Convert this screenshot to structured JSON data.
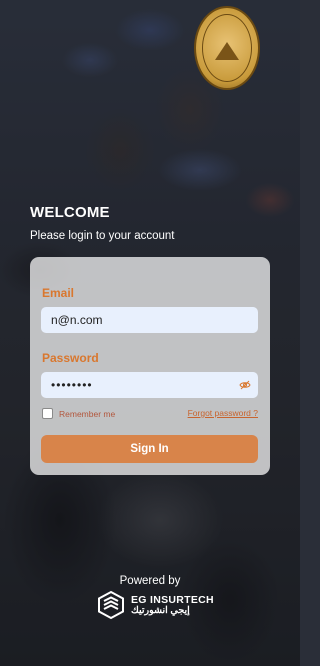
{
  "header": {
    "logo_icon": "association-seal-icon"
  },
  "welcome": {
    "title": "WELCOME",
    "subtitle": "Please login to your account"
  },
  "form": {
    "email_label": "Email",
    "email_value": "n@n.com",
    "password_label": "Password",
    "password_value": "••••••••",
    "remember_label": "Remember me",
    "remember_checked": false,
    "forgot_label": "Forgot password ?",
    "signin_label": "Sign In"
  },
  "footer": {
    "powered_by": "Powered by",
    "brand_en": "EG INSURTECH",
    "brand_ar": "إيجي انشورتيك"
  },
  "colors": {
    "accent": "#d9772e",
    "button": "#d8844a",
    "input_bg": "#e8f0fd"
  }
}
